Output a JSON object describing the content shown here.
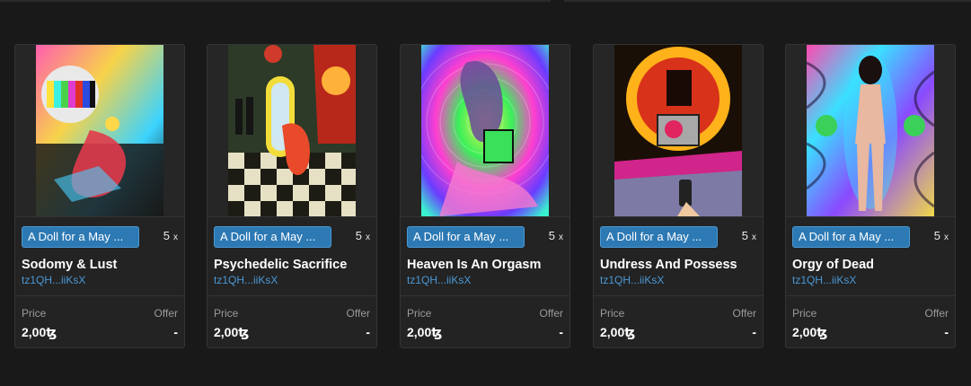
{
  "cards": [
    {
      "collection": "A Doll for a May ...",
      "edition": "5",
      "edition_suffix": "x",
      "title": "Sodomy & Lust",
      "creator": "tz1QH...iiKsX",
      "price_label": "Price",
      "offer_label": "Offer",
      "price": "2,00ꜩ",
      "offer": "-",
      "art_palette": [
        "#2a2a2a",
        "#ff3a8c",
        "#f6d44a",
        "#34d0ff"
      ]
    },
    {
      "collection": "A Doll for a May ...",
      "edition": "5",
      "edition_suffix": "x",
      "title": "Psychedelic Sacrifice",
      "creator": "tz1QH...iiKsX",
      "price_label": "Price",
      "offer_label": "Offer",
      "price": "2,00ꜩ",
      "offer": "-",
      "art_palette": [
        "#0d0d0d",
        "#f0d23a",
        "#ff4b2a",
        "#c7b98a"
      ]
    },
    {
      "collection": "A Doll for a May ...",
      "edition": "5",
      "edition_suffix": "x",
      "title": "Heaven Is An Orgasm",
      "creator": "tz1QH...iiKsX",
      "price_label": "Price",
      "offer_label": "Offer",
      "price": "2,00ꜩ",
      "offer": "-",
      "art_palette": [
        "#ff3fd0",
        "#3af05a",
        "#6a3cff",
        "#f7f04a"
      ]
    },
    {
      "collection": "A Doll for a May ...",
      "edition": "5",
      "edition_suffix": "x",
      "title": "Undress And Possess",
      "creator": "tz1QH...iiKsX",
      "price_label": "Price",
      "offer_label": "Offer",
      "price": "2,00ꜩ",
      "offer": "-",
      "art_palette": [
        "#1a0f06",
        "#ff9a1a",
        "#e0255f",
        "#2ad0c0"
      ]
    },
    {
      "collection": "A Doll for a May ...",
      "edition": "5",
      "edition_suffix": "x",
      "title": "Orgy of Dead",
      "creator": "tz1QH...iiKsX",
      "price_label": "Price",
      "offer_label": "Offer",
      "price": "2,00ꜩ",
      "offer": "-",
      "art_palette": [
        "#3a2a6a",
        "#ff4ab0",
        "#3ae0ff",
        "#f0d84a"
      ]
    }
  ]
}
